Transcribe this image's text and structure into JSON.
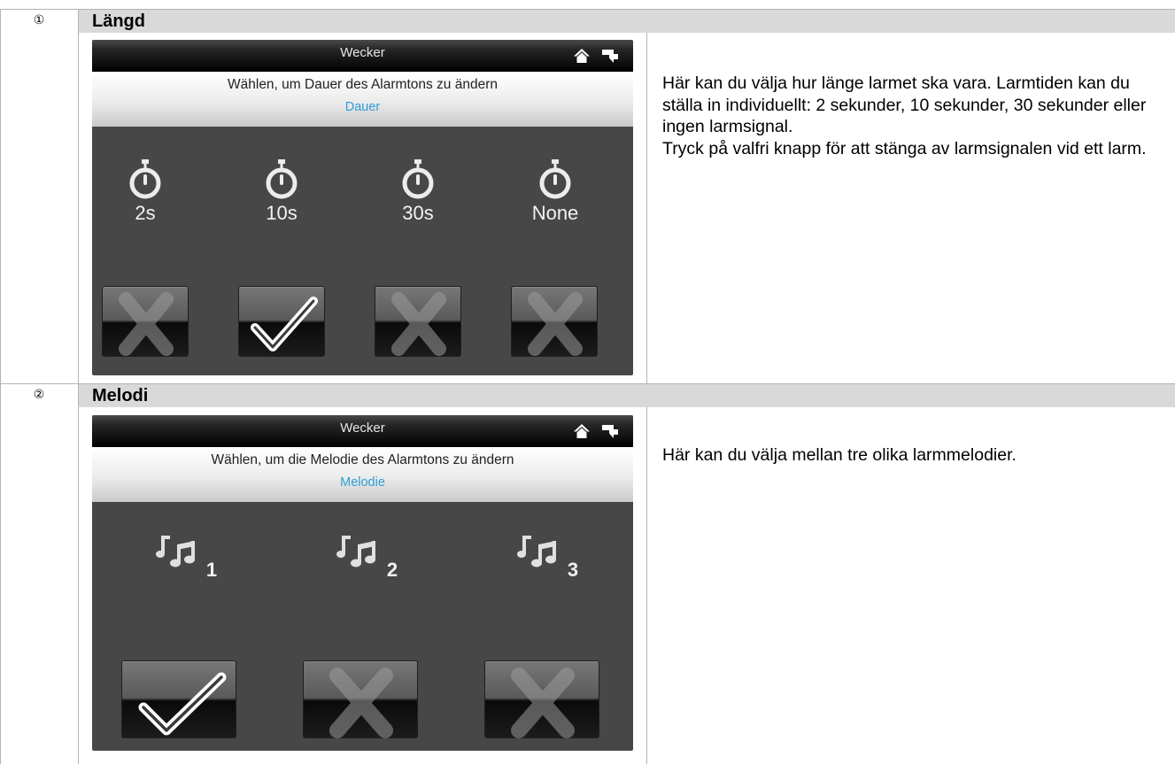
{
  "sections": [
    {
      "number": "①",
      "title": "Längd",
      "screen": {
        "title": "Wecker",
        "home_icon": "home-icon",
        "back_icon": "back-icon",
        "prompt": "Wählen, um Dauer des Alarmtons zu ändern",
        "active_label": "Dauer",
        "options": [
          {
            "label": "2s",
            "icon": "stopwatch-icon",
            "selected": false
          },
          {
            "label": "10s",
            "icon": "stopwatch-icon",
            "selected": true
          },
          {
            "label": "30s",
            "icon": "stopwatch-icon",
            "selected": false
          },
          {
            "label": "None",
            "icon": "stopwatch-icon",
            "selected": false
          }
        ]
      },
      "description": [
        "Här kan du välja hur länge larmet ska vara. Larmtiden kan du ställa in individuellt: 2 sekunder, 10 sekunder, 30 sekunder eller ingen larmsignal.",
        "Tryck på valfri knapp för att stänga av larmsignalen vid ett larm."
      ]
    },
    {
      "number": "②",
      "title": "Melodi",
      "screen": {
        "title": "Wecker",
        "home_icon": "home-icon",
        "back_icon": "back-icon",
        "prompt": "Wählen, um die Melodie des Alarmtons zu ändern",
        "active_label": "Melodie",
        "options": [
          {
            "label": "1",
            "icon": "music-note-icon",
            "selected": true
          },
          {
            "label": "2",
            "icon": "music-note-icon",
            "selected": false
          },
          {
            "label": "3",
            "icon": "music-note-icon",
            "selected": false
          }
        ]
      },
      "description": [
        "Här kan du välja mellan tre olika larmmelodier."
      ]
    }
  ],
  "colors": {
    "header_band": "#d9d9d9",
    "screen_bg": "#474747",
    "accent_blue": "#2f9ed6"
  }
}
